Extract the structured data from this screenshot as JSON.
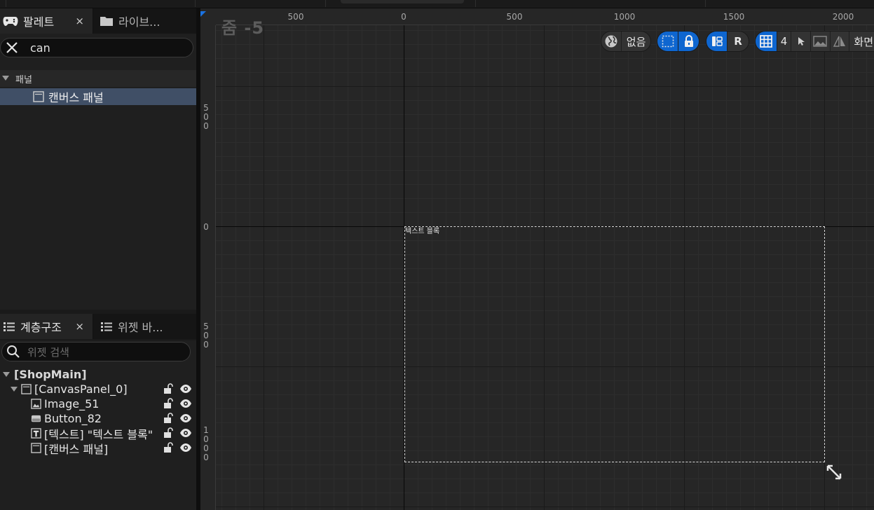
{
  "palette_tab": {
    "title": "팔레트",
    "close": "×"
  },
  "library_tab": {
    "title": "라이브..."
  },
  "palette_search": {
    "value": "can"
  },
  "palette_tree": {
    "category": "패널",
    "item": "캔버스 패널"
  },
  "hierarchy_tab": {
    "title": "계층구조",
    "close": "×"
  },
  "widget_tab": {
    "title": "위젯 바..."
  },
  "hierarchy_search": {
    "placeholder": "위젯 검색"
  },
  "hierarchy_tree": {
    "root": "[ShopMain]",
    "canvas": "[CanvasPanel_0]",
    "children": [
      "Image_51",
      "Button_82",
      "[텍스트] \"텍스트 블록\"",
      "[캔버스 패널]"
    ]
  },
  "designer": {
    "zoom_label": "줌 -5",
    "ruler_top": [
      "500",
      "0",
      "500",
      "1000",
      "1500",
      "2000"
    ],
    "ruler_left": [
      [
        "5",
        "0",
        "0"
      ],
      [
        "0"
      ],
      [
        "5",
        "0",
        "0"
      ],
      [
        "1",
        "0",
        "0",
        "0"
      ]
    ],
    "canvas_text": "텍스트 블록",
    "toolbar": {
      "localization": "없음",
      "respect_locks": "R",
      "grid_snap": "4",
      "screen": "화면"
    }
  },
  "colors": {
    "accent": "#0e66d0",
    "selection": "#404f66"
  }
}
